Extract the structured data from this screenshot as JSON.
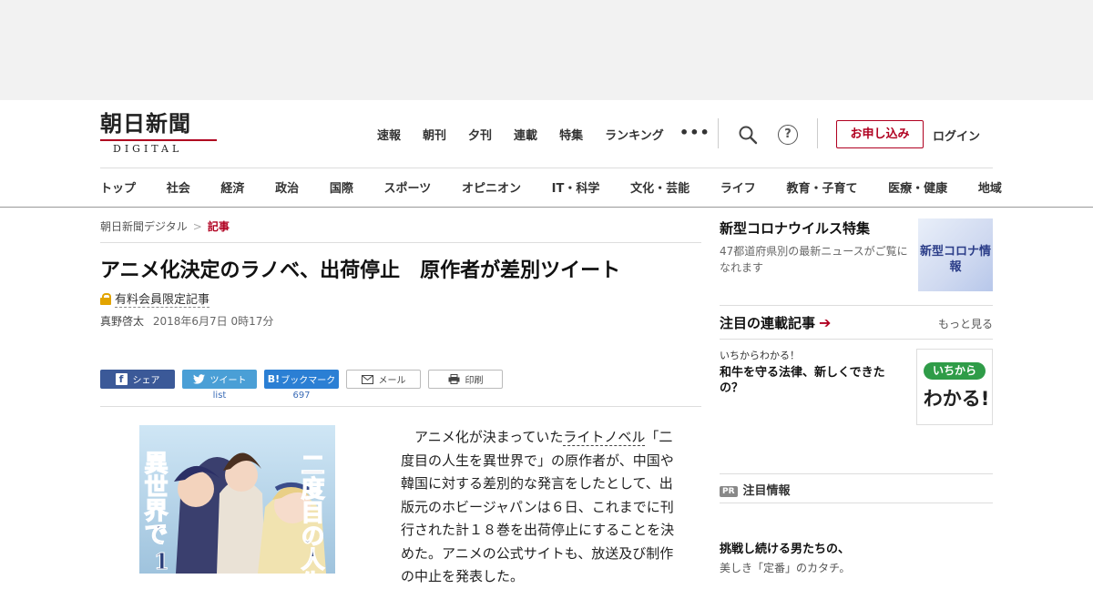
{
  "header": {
    "logo_main": "朝日新聞",
    "logo_sub": "DIGITAL",
    "top_nav": [
      "速報",
      "朝刊",
      "夕刊",
      "連載",
      "特集",
      "ランキング"
    ],
    "more": "•••",
    "help": "?",
    "apply_label": "お申し込み",
    "login_label": "ログイン",
    "categories": [
      "トップ",
      "社会",
      "経済",
      "政治",
      "国際",
      "スポーツ",
      "オピニオン",
      "IT・科学",
      "文化・芸能",
      "ライフ",
      "教育・子育て",
      "医療・健康",
      "地域"
    ]
  },
  "breadcrumb": {
    "home": "朝日新聞デジタル",
    "sep": ">",
    "current": "記事"
  },
  "article": {
    "title": "アニメ化決定のラノベ、出荷停止　原作者が差別ツイート",
    "paid_label": "有料会員限定記事",
    "author": "真野啓太",
    "date": "2018年6月7日 0時17分",
    "body_intro": "アニメ化が決まっていた",
    "body_link": "ライトノベル",
    "body_rest": "「二度目の人生を異世界で」の原作者が、中国や韓国に対する差別的な発言をしたとして、出版元のホビージャパンは６日、これまでに刊行された計１８巻を出荷停止にすることを決めた。アニメの公式サイトも、放送及び制作の中止を発表した。",
    "book_title_1": "二度目の人生",
    "book_title_2": "異世界で",
    "book_vol": "1"
  },
  "share": {
    "facebook": "シェア",
    "twitter": "ツイート",
    "twitter_count": "list",
    "hatena": "ブックマーク",
    "hatena_icon": "B!",
    "hatena_count": "697",
    "mail": "メール",
    "print": "印刷"
  },
  "sidebar": {
    "corona_heading": "新型コロナウイルス特集",
    "corona_text": "47都道府県別の最新ニュースがご覧になれます",
    "corona_badge": "新型コロナ情報",
    "series_heading": "注目の連載記事",
    "series_more": "もっと見る",
    "series_kicker": "いちからわかる！",
    "series_title": "和牛を守る法律、新しくできたの？",
    "ichi_logo_top": "いちから",
    "ichi_logo_bottom": "わかる!",
    "pr_badge": "PR",
    "pr_heading": "注目情報",
    "pr_title": "挑戦し続ける男たちの、",
    "pr_sub": "美しき「定番」のカタチ。"
  },
  "colors": {
    "brand_red": "#b00020",
    "facebook": "#3b5998",
    "twitter": "#4a9fd6",
    "hatena": "#2b7fd4"
  }
}
